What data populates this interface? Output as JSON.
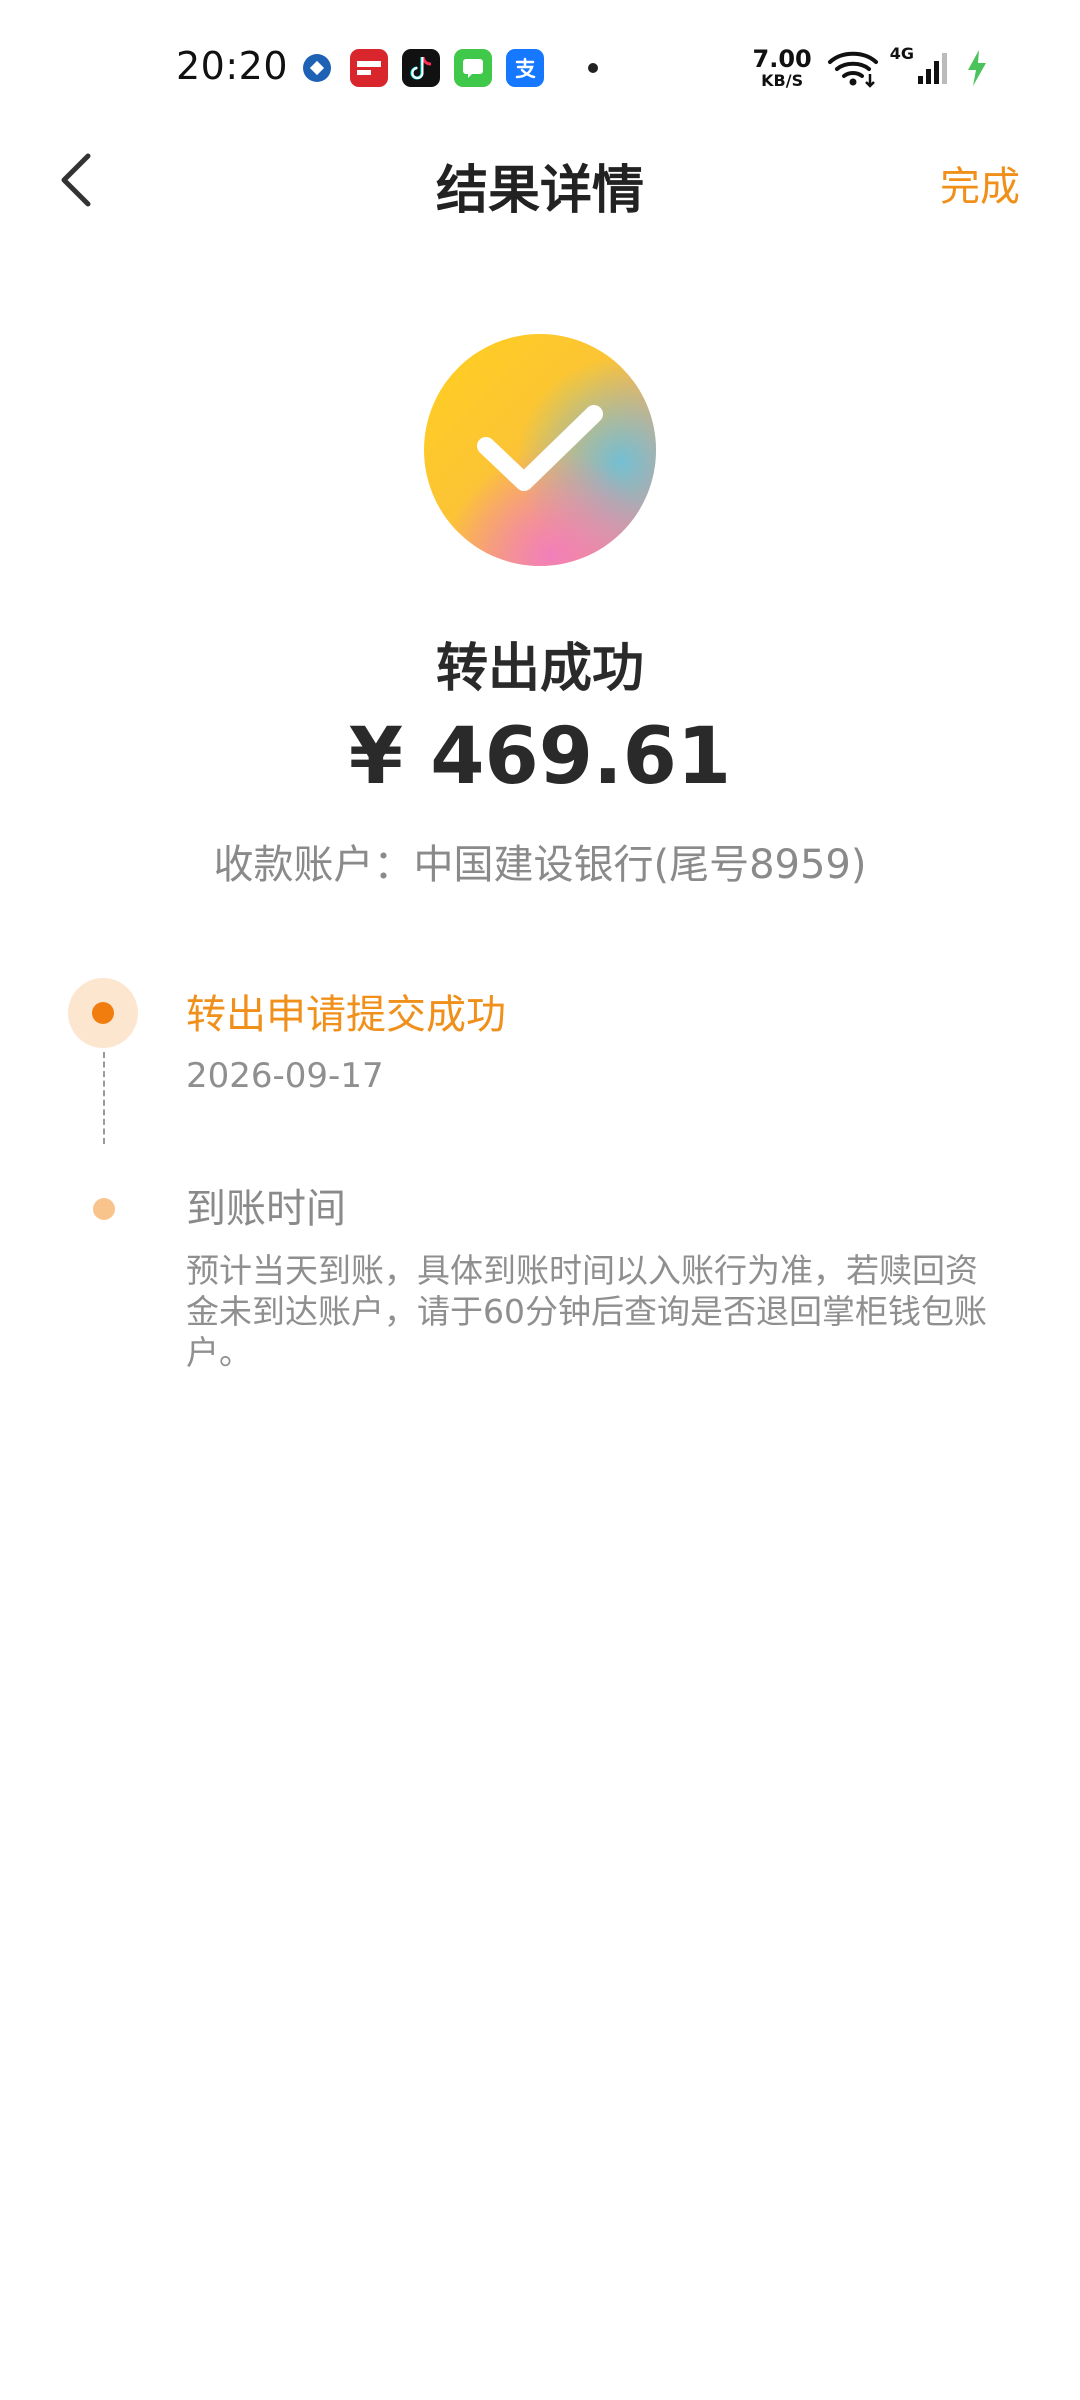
{
  "status_bar": {
    "time": "20:20",
    "net_speed_value": "7.00",
    "net_speed_unit": "KB/S",
    "network_type": "4G",
    "app_icons": [
      {
        "name": "ccb-app-icon",
        "color": "#1f62b5"
      },
      {
        "name": "unionpay-app-icon",
        "color": "#d9262c"
      },
      {
        "name": "tiktok-app-icon",
        "color": "#111111"
      },
      {
        "name": "messages-app-icon",
        "color": "#3fc84a"
      },
      {
        "name": "alipay-app-icon",
        "color": "#1677ff"
      }
    ]
  },
  "nav": {
    "title": "结果详情",
    "done_label": "完成"
  },
  "result": {
    "status": "转出成功",
    "amount": "¥ 469.61",
    "account": "收款账户：中国建设银行(尾号8959)"
  },
  "timeline": [
    {
      "title": "转出申请提交成功",
      "date": "2026-09-17"
    },
    {
      "title": "到账时间",
      "desc": "预计当天到账，具体到账时间以入账行为准，若赎回资金未到达账户，请于60分钟后查询是否退回掌柜钱包账户。"
    }
  ],
  "colors": {
    "accent": "#f0901a",
    "timeline_active": "#f27d0f",
    "timeline_inactive": "#f9c48c",
    "text_primary": "#2a2a2a",
    "text_secondary": "#8a8a8a"
  }
}
